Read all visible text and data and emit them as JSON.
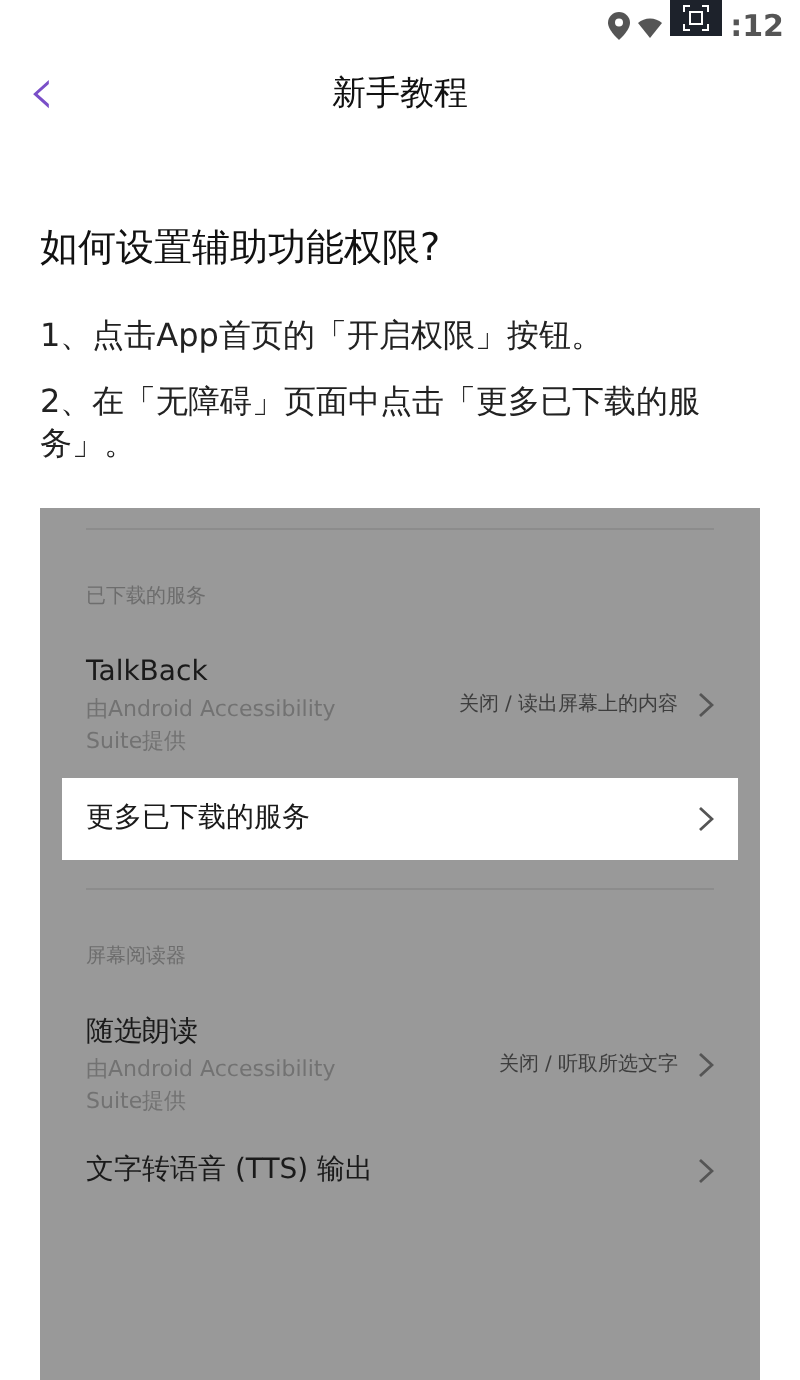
{
  "status_bar": {
    "time": ":12"
  },
  "header": {
    "title": "新手教程",
    "back": "‹"
  },
  "heading": "如何设置辅助功能权限?",
  "steps": [
    "1、点击App首页的「开启权限」按钮。",
    "2、在「无障碍」页面中点击「更多已下载的服务」。"
  ],
  "screenshot": {
    "sections": [
      {
        "header": "已下载的服务",
        "rows": [
          {
            "title": "TalkBack",
            "subtitle": "由Android Accessibility Suite提供",
            "value": "关闭 / 读出屏幕上的内容",
            "selected": false
          },
          {
            "title": "更多已下载的服务",
            "selected": true
          }
        ]
      },
      {
        "header": "屏幕阅读器",
        "rows": [
          {
            "title": "随选朗读",
            "subtitle": "由Android Accessibility Suite提供",
            "value": "关闭 / 听取所选文字",
            "selected": false
          },
          {
            "title": "文字转语音 (TTS) 输出",
            "selected": false
          }
        ]
      }
    ]
  }
}
